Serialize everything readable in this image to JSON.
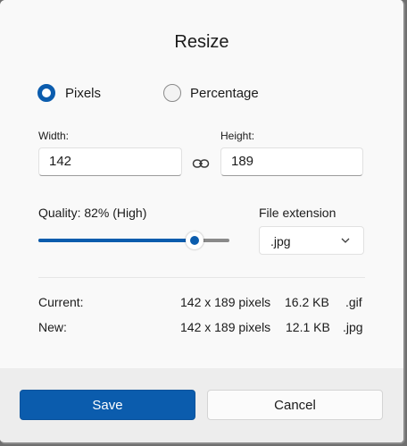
{
  "dialog": {
    "title": "Resize"
  },
  "mode": {
    "pixels_label": "Pixels",
    "percentage_label": "Percentage",
    "selected": "pixels"
  },
  "size": {
    "width_label": "Width:",
    "width_value": "142",
    "height_label": "Height:",
    "height_value": "189",
    "link_icon": "link-icon"
  },
  "quality": {
    "label": "Quality: 82% (High)",
    "value_percent": 82
  },
  "extension": {
    "label": "File extension",
    "selected": ".jpg",
    "chevron_icon": "chevron-down-icon"
  },
  "info": {
    "current": {
      "label": "Current:",
      "dimensions": "142 x 189 pixels",
      "size": "16.2 KB",
      "ext": ".gif"
    },
    "new": {
      "label": "New:",
      "dimensions": "142 x 189 pixels",
      "size": "12.1 KB",
      "ext": ".jpg"
    }
  },
  "buttons": {
    "save_label": "Save",
    "cancel_label": "Cancel"
  },
  "colors": {
    "accent": "#0b5cad",
    "background": "#f9f9f9",
    "footer": "#ededed"
  }
}
